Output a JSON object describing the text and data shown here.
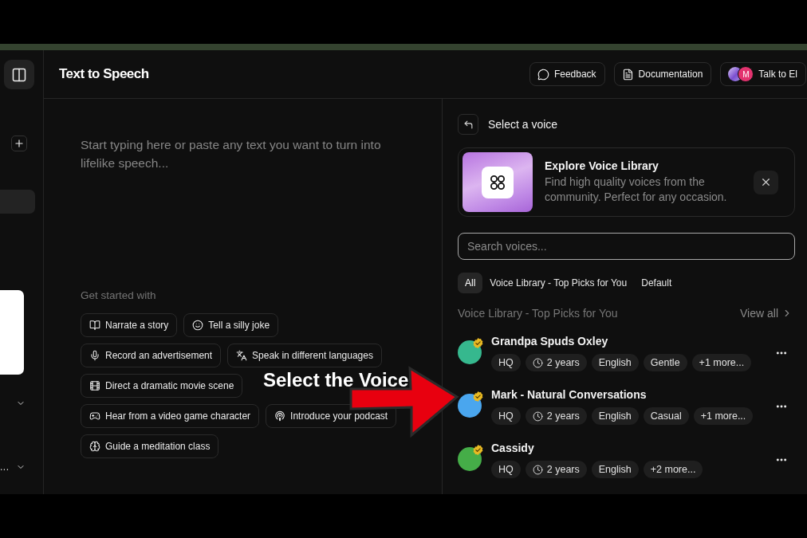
{
  "header": {
    "title": "Text to Speech",
    "buttons": [
      {
        "kind": "feedback",
        "label": "Feedback"
      },
      {
        "kind": "docs",
        "label": "Documentation"
      },
      {
        "kind": "agent",
        "label": "Talk to El",
        "avatar_letter": "M"
      }
    ]
  },
  "sidebar": {
    "items": [
      {
        "kind": "nav",
        "selected": true
      },
      {
        "kind": "card"
      },
      {
        "kind": "section",
        "expanded": false
      },
      {
        "kind": "section",
        "label": "...",
        "expanded": false
      }
    ]
  },
  "editor": {
    "placeholder": "Start typing here or paste any text you want to turn into lifelike speech...",
    "suggestions_title": "Get started with",
    "suggestions": [
      {
        "kind": "story",
        "label": "Narrate a story"
      },
      {
        "kind": "joke",
        "label": "Tell a silly joke"
      },
      {
        "kind": "ad",
        "label": "Record an advertisement"
      },
      {
        "kind": "languages",
        "label": "Speak in different languages"
      },
      {
        "kind": "movie",
        "label": "Direct a dramatic movie scene"
      },
      {
        "kind": "game",
        "label": "Hear from a video game character"
      },
      {
        "kind": "podcast",
        "label": "Introduce your podcast"
      },
      {
        "kind": "meditation",
        "label": "Guide a meditation class"
      }
    ]
  },
  "voice_panel": {
    "title": "Select a voice",
    "promo": {
      "title": "Explore Voice Library",
      "description": "Find high quality voices from the community. Perfect for any occasion."
    },
    "search": {
      "placeholder": "Search voices..."
    },
    "filters": [
      {
        "label": "All",
        "selected": true
      },
      {
        "label": "Voice Library - Top Picks for You",
        "selected": false
      },
      {
        "label": "Default",
        "selected": false
      }
    ],
    "section": {
      "title": "Voice Library - Top Picks for You",
      "link": "View all"
    },
    "voices": [
      {
        "name": "Grandpa Spuds Oxley",
        "color": "#36b88e",
        "verified": true,
        "tags": [
          {
            "kind": "plain",
            "text": "HQ"
          },
          {
            "kind": "age",
            "text": "2 years"
          },
          {
            "kind": "plain",
            "text": "English"
          },
          {
            "kind": "plain",
            "text": "Gentle"
          },
          {
            "kind": "plain",
            "text": "+1 more..."
          }
        ]
      },
      {
        "name": "Mark - Natural Conversations",
        "color": "#4aa6ee",
        "verified": true,
        "tags": [
          {
            "kind": "plain",
            "text": "HQ"
          },
          {
            "kind": "age",
            "text": "2 years"
          },
          {
            "kind": "plain",
            "text": "English"
          },
          {
            "kind": "plain",
            "text": "Casual"
          },
          {
            "kind": "plain",
            "text": "+1 more..."
          }
        ]
      },
      {
        "name": "Cassidy",
        "color": "#45ad48",
        "verified": true,
        "tags": [
          {
            "kind": "plain",
            "text": "HQ"
          },
          {
            "kind": "age",
            "text": "2 years"
          },
          {
            "kind": "plain",
            "text": "English"
          },
          {
            "kind": "plain",
            "text": "+2 more..."
          }
        ]
      }
    ]
  },
  "annotation": {
    "text": "Select the Voice"
  }
}
